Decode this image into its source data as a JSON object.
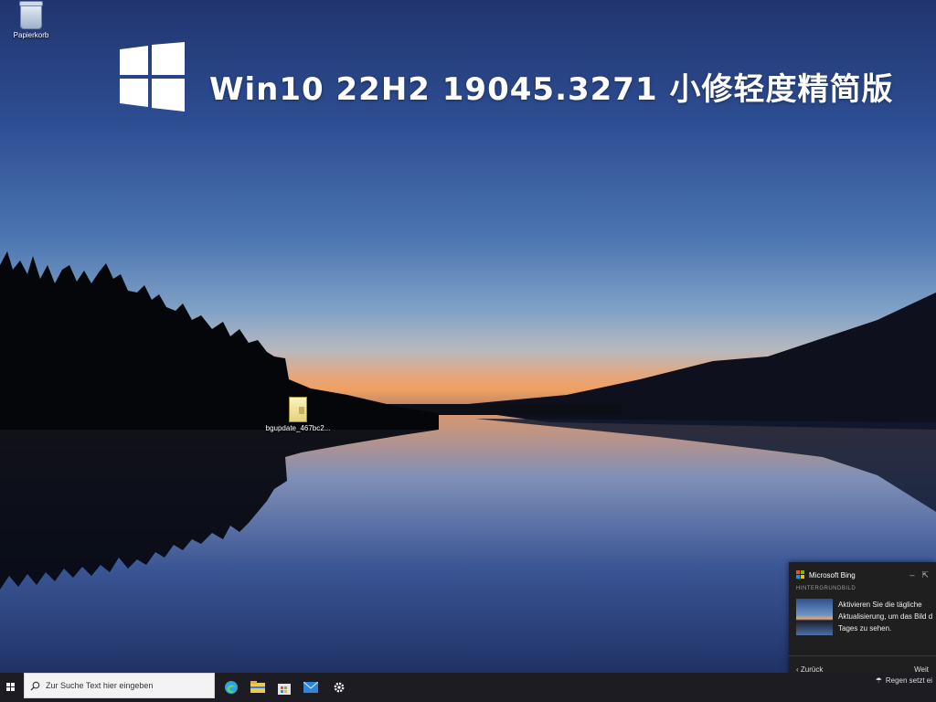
{
  "headline": "Win10 22H2 19045.3271 小修轻度精简版",
  "desktop_icons": {
    "recycle_bin": "Papierkorb",
    "file": "bgupdate_467bc2..."
  },
  "bing_panel": {
    "title": "Microsoft Bing",
    "section": "HINTERGRUNDBILD",
    "message_line1": "Aktivieren Sie die tägliche",
    "message_line2": "Aktualisierung, um das Bild d",
    "message_line3": "Tages zu sehen.",
    "back": "Zurück",
    "next": "Weit"
  },
  "taskbar": {
    "search_placeholder": "Zur Suche Text hier eingeben",
    "tray_text": "Regen setzt ei"
  },
  "colors": {
    "win_logo": "#ffffff",
    "taskbar": "#1c1c22",
    "bing_panel": "#1f1f1f",
    "edge": "#2fa3e0",
    "explorer": "#f2c94c",
    "mail": "#2f86d6"
  }
}
